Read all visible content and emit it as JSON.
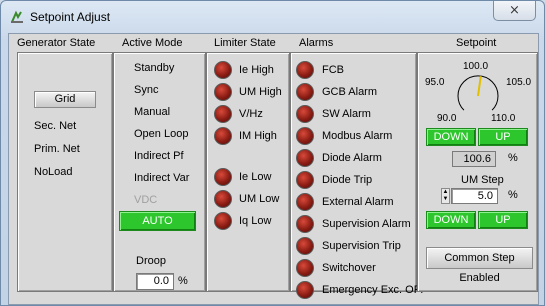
{
  "window": {
    "title": "Setpoint Adjust",
    "close_glyph": "⨯",
    "icon": "setpoint-app-icon",
    "close_icon": "close-icon"
  },
  "headers": {
    "generator_state": "Generator State",
    "active_mode": "Active Mode",
    "limiter_state": "Limiter State",
    "alarms": "Alarms",
    "setpoint": "Setpoint"
  },
  "generator_state": {
    "grid_button": "Grid",
    "items": [
      "Sec. Net",
      "Prim. Net",
      "NoLoad"
    ]
  },
  "active_mode": {
    "items": [
      {
        "label": "Standby",
        "disabled": false
      },
      {
        "label": "Sync",
        "disabled": false
      },
      {
        "label": "Manual",
        "disabled": false
      },
      {
        "label": "Open Loop",
        "disabled": false
      },
      {
        "label": "Indirect Pf",
        "disabled": false
      },
      {
        "label": "Indirect Var",
        "disabled": false
      },
      {
        "label": "VDC",
        "disabled": true
      }
    ],
    "auto_button": "AUTO",
    "droop_label": "Droop",
    "droop_value": "0.0",
    "droop_unit": "%"
  },
  "limiter_state": {
    "high": [
      "Ie High",
      "UM High",
      "V/Hz",
      "IM High"
    ],
    "low": [
      "Ie Low",
      "UM Low",
      "Iq Low"
    ]
  },
  "alarms": [
    "FCB",
    "GCB Alarm",
    "SW Alarm",
    "Modbus Alarm",
    "Diode Alarm",
    "Diode Trip",
    "External Alarm",
    "Supervision Alarm",
    "Supervision Trip",
    "Switchover",
    "Emergency Exc. OFF"
  ],
  "setpoint": {
    "dial_ticks": {
      "top": "100.0",
      "left": "95.0",
      "right": "105.0",
      "bottom_left": "90.0",
      "bottom_right": "110.0"
    },
    "dial_value_percent": 100.6,
    "down_label": "DOWN",
    "up_label": "UP",
    "value": "100.6",
    "unit": "%",
    "um_step_label": "UM Step",
    "um_step_value": "5.0",
    "um_step_unit": "%",
    "common_step_button": "Common Step Enabled"
  },
  "colors": {
    "accent_green": "#2dc72d",
    "led_red": "#8c1d14",
    "panel_gray": "#d9d9d9"
  }
}
